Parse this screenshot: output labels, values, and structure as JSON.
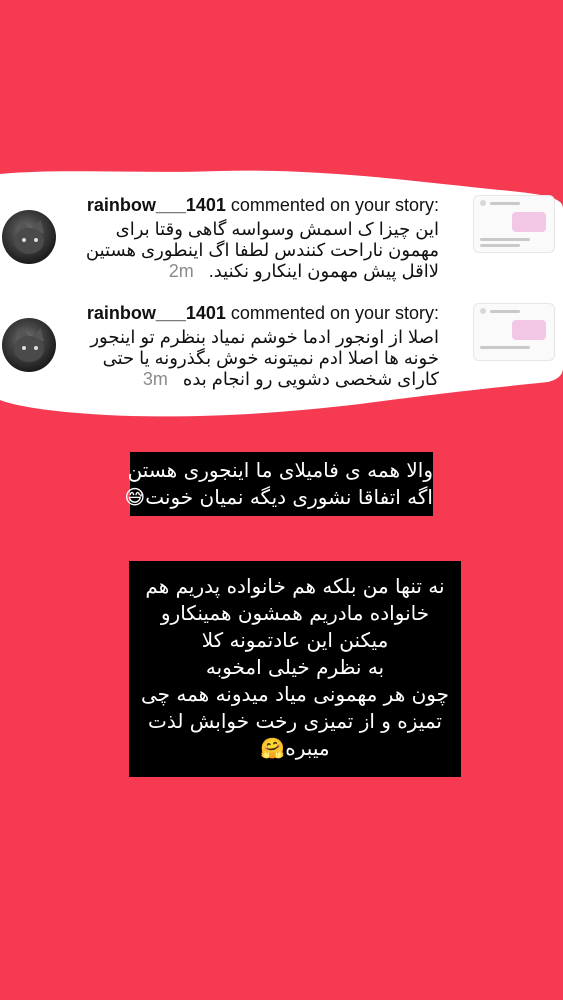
{
  "colors": {
    "background": "#f53a52",
    "card": "#ffffff",
    "text_box": "#000000"
  },
  "comments": [
    {
      "username": "rainbow___1401",
      "action": "commented on your story:",
      "text": "این چیزا ک اسمش وسواسه گاهی وقتا برای مهمون ناراحت کنندس لطفا اگ اینطوری هستین لااقل پیش مهمون اینکارو نکنید.",
      "time": "2m",
      "avatar_icon": "cat-avatar-icon"
    },
    {
      "username": "rainbow___1401",
      "action": "commented on your story:",
      "text": "اصلا از اونجور ادما خوشم نمیاد بنظرم تو اینجور خونه ها اصلا ادم نمیتونه خوش بگذرونه یا حتی کارای شخصی دشویی رو انجام بده",
      "time": "3m",
      "avatar_icon": "cat-avatar-icon"
    }
  ],
  "reply_boxes": [
    {
      "lines": [
        "والا همه ی فامیلای ما اینجوری هستن",
        "اگه اتفاقا نشوری دیگه نمیان خونت😅"
      ]
    },
    {
      "lines": [
        "نه تنها من بلکه هم خانواده پدریم هم",
        "خانواده مادریم همشون همینکارو",
        "میکنن این عادتمونه کلا",
        "به نظرم خیلی امخوبه",
        "چون هر مهمونی میاد میدونه همه چی",
        "تمیزه و از تمیزی رخت خوابش لذت",
        "میبره🤗"
      ]
    }
  ]
}
